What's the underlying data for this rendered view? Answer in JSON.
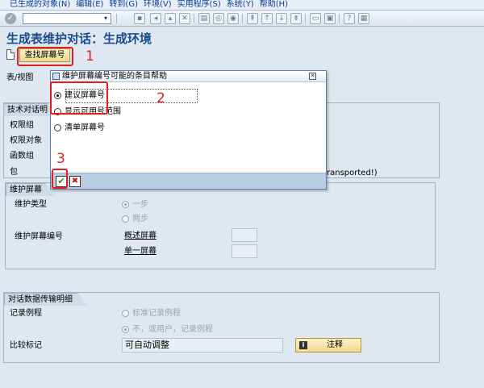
{
  "menu": [
    "已生成的对象(N)",
    "编辑(E)",
    "转到(G)",
    "环境(V)",
    "实用程序(S)",
    "系统(Y)",
    "帮助(H)"
  ],
  "page_title": "生成表维护对话：生成环境",
  "app_toolbar": {
    "find_screen_button": "查找屏幕号"
  },
  "annotations": [
    "1",
    "2",
    "3"
  ],
  "fields": {
    "table_view": "表/视图",
    "tech_dialog_tab": "技术对话明",
    "auth_group": "权限组",
    "auth_object": "权限对象",
    "function_group": "函数组",
    "package": "包",
    "transported_text": "ransported!)"
  },
  "maint_screen": {
    "tab": "维护屏幕",
    "maint_type_label": "维护类型",
    "one_step": "一步",
    "two_step": "两步",
    "screen_no_label": "维护屏幕编号",
    "overview_screen": "概述屏幕",
    "single_screen": "单一屏幕"
  },
  "dialog_data": {
    "tab": "对话数据传输明细",
    "recording_label": "记录例程",
    "standard_routine": "标准记录例程",
    "no_routine": "不，或用户，记录例程",
    "compare_label": "比较标记",
    "compare_value": "可自动调整",
    "notes_button": "注释"
  },
  "popup": {
    "title": "维护屏幕编号可能的条目帮助",
    "options": [
      "建议屏幕号",
      "显示可用号范围",
      "清单屏幕号"
    ],
    "selected_index": 0
  },
  "colors": {
    "annotation_red": "#e02020",
    "title_blue": "#1b4b8a",
    "menu_blue": "#0a3d8f",
    "button_yellow": "#f0d98d"
  }
}
